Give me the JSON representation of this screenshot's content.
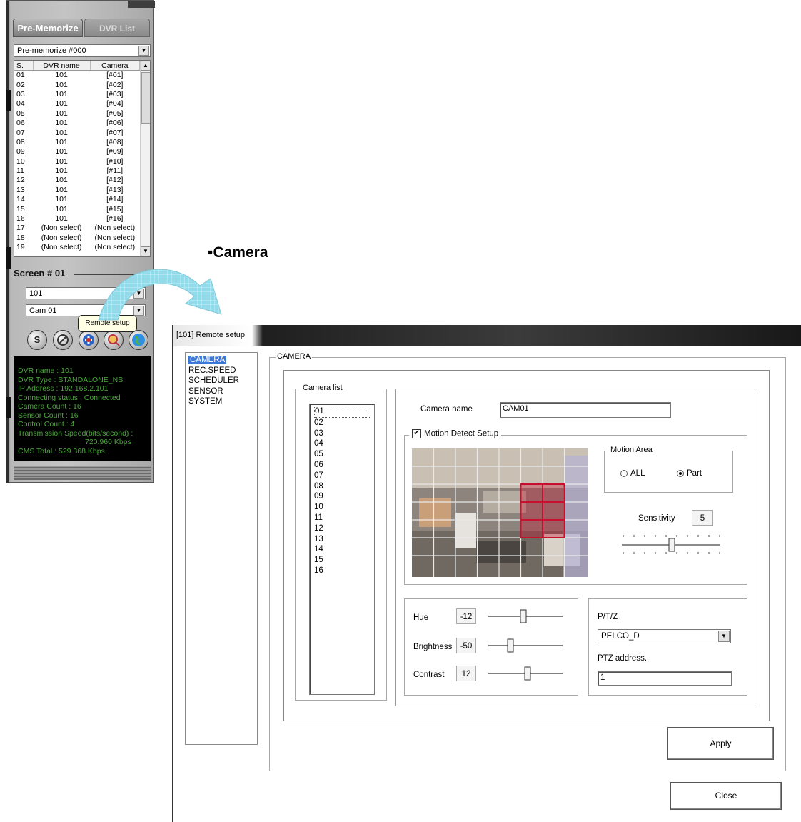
{
  "left_panel": {
    "tabs": {
      "pre_memorize": "Pre-Memorize",
      "dvr_list": "DVR List"
    },
    "premem_select": "Pre-memorize #000",
    "table": {
      "headers": [
        "S.",
        "DVR name",
        "Camera"
      ],
      "rows": [
        [
          "01",
          "101",
          "[#01]"
        ],
        [
          "02",
          "101",
          "[#02]"
        ],
        [
          "03",
          "101",
          "[#03]"
        ],
        [
          "04",
          "101",
          "[#04]"
        ],
        [
          "05",
          "101",
          "[#05]"
        ],
        [
          "06",
          "101",
          "[#06]"
        ],
        [
          "07",
          "101",
          "[#07]"
        ],
        [
          "08",
          "101",
          "[#08]"
        ],
        [
          "09",
          "101",
          "[#09]"
        ],
        [
          "10",
          "101",
          "[#10]"
        ],
        [
          "11",
          "101",
          "[#11]"
        ],
        [
          "12",
          "101",
          "[#12]"
        ],
        [
          "13",
          "101",
          "[#13]"
        ],
        [
          "14",
          "101",
          "[#14]"
        ],
        [
          "15",
          "101",
          "[#15]"
        ],
        [
          "16",
          "101",
          "[#16]"
        ],
        [
          "17",
          "(Non select)",
          "(Non select)"
        ],
        [
          "18",
          "(Non select)",
          "(Non select)"
        ],
        [
          "19",
          "(Non select)",
          "(Non select)"
        ]
      ]
    },
    "screen_label": "Screen # 01",
    "dvr_select": "101",
    "cam_select": "Cam 01",
    "tooltip": "Remote setup",
    "round_buttons": [
      "S",
      "",
      "",
      "",
      ""
    ],
    "info": [
      "DVR name : 101",
      "DVR Type : STANDALONE_NS",
      "IP Address : 192.168.2.101",
      "Connecting status : Connected",
      "Camera Count : 16",
      "Sensor Count : 16",
      "Control Count : 4",
      "Transmission Speed(bits/second) :",
      "720.960 Kbps",
      "CMS Total : 529.368 Kbps"
    ]
  },
  "caption": "▪Camera",
  "dialog": {
    "title": "[101] Remote setup",
    "nav": [
      "CAMERA",
      "REC.SPEED",
      "SCHEDULER",
      "SENSOR",
      "SYSTEM"
    ],
    "group_title": "CAMERA",
    "camlist_title": "Camera list",
    "cameras": [
      "01",
      "02",
      "03",
      "04",
      "05",
      "06",
      "07",
      "08",
      "09",
      "10",
      "11",
      "12",
      "13",
      "14",
      "15",
      "16"
    ],
    "camera_name_label": "Camera name",
    "camera_name_value": "CAM01",
    "motion_detect_label": "Motion Detect Setup",
    "motion_area_title": "Motion Area",
    "radio_all": "ALL",
    "radio_part": "Part",
    "motion_area_selected": "Part",
    "sensitivity_label": "Sensitivity",
    "sensitivity_value": "5",
    "hue_label": "Hue",
    "hue_value": "-12",
    "brightness_label": "Brightness",
    "brightness_value": "-50",
    "contrast_label": "Contrast",
    "contrast_value": "12",
    "ptz_label": "P/T/Z",
    "ptz_protocol": "PELCO_D",
    "ptz_address_label": "PTZ address.",
    "ptz_address_value": "1",
    "apply_label": "Apply",
    "close_label": "Close"
  },
  "colors": {
    "selection": "#3b78d8",
    "info_text": "#4aa83a",
    "motion_cell": "#c8102e",
    "arrow": "#7fd6e6"
  }
}
